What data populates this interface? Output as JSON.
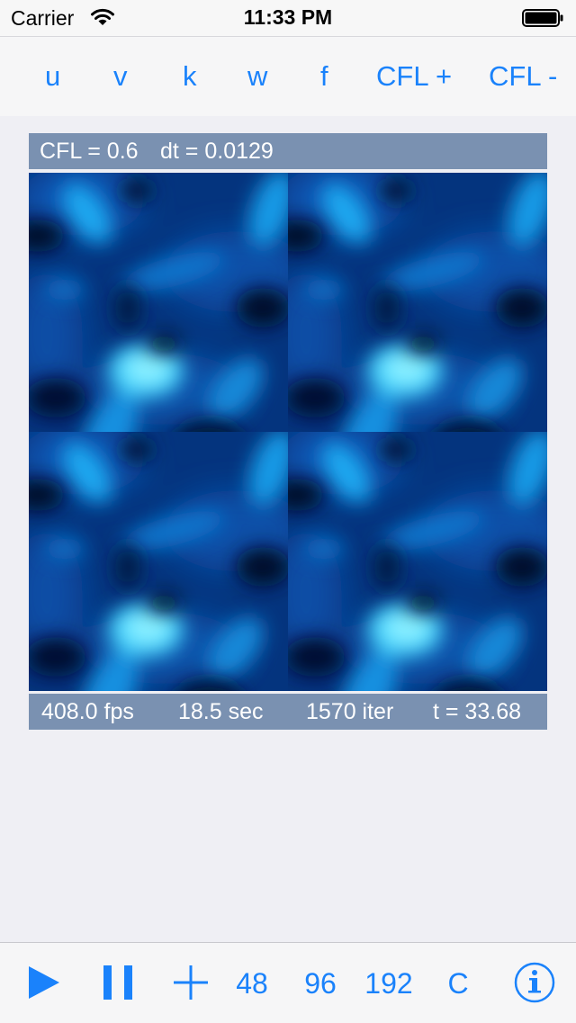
{
  "status_bar": {
    "carrier": "Carrier",
    "time": "11:33 PM"
  },
  "top_toolbar": {
    "buttons": [
      "u",
      "v",
      "k",
      "w",
      "f",
      "CFL +",
      "CFL -"
    ]
  },
  "info_bar": {
    "cfl": "CFL = 0.6",
    "dt": "dt = 0.0129"
  },
  "stats_bar": {
    "fps": "408.0 fps",
    "elapsed": "18.5 sec",
    "iterations": "1570 iter",
    "sim_time": "t = 33.68"
  },
  "bottom_toolbar": {
    "grid_48": "48",
    "grid_96": "96",
    "grid_192": "192",
    "c_label": "C",
    "icons": [
      "play-icon",
      "pause-icon",
      "plus-icon",
      "info-icon"
    ]
  },
  "colors": {
    "accent": "#1a82fb",
    "bar_background": "#7a91b1",
    "page_background": "#efeff4",
    "field_dark": "#032a6a",
    "field_bright": "#4fe0ff"
  }
}
